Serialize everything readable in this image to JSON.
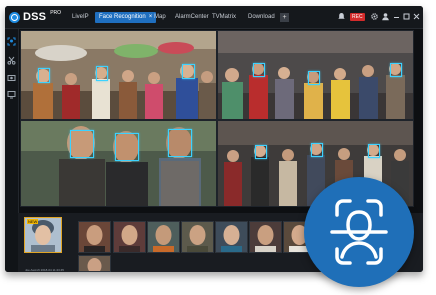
{
  "app": {
    "logo": "DSS",
    "logo_sub": "PRO"
  },
  "tabs": [
    {
      "label": "LiveIP"
    },
    {
      "label": "Face Recognition",
      "close": "×"
    },
    {
      "label": "Map"
    },
    {
      "label": "AlarmCenter"
    },
    {
      "label": "TVMatrix"
    },
    {
      "label": "Download"
    }
  ],
  "toolbar": {
    "add_label": "+",
    "rec_label": "REC"
  },
  "thumbnail_caption": "Joe Ascroft 2018-04 11:23:45",
  "thumbnail_tag": "NEW",
  "icons": {
    "top": [
      "gear-icon",
      "user-icon",
      "minimize-icon",
      "maximize-icon",
      "close-icon"
    ],
    "sidebar": [
      "face-scan-icon",
      "scissors-icon",
      "camera-icon",
      "monitor-icon"
    ],
    "badge": "face-recognition-icon"
  },
  "colors": {
    "accent": "#1f6fc0",
    "detection_box": "#3cd2ff",
    "badge": "#1f6fb8"
  }
}
